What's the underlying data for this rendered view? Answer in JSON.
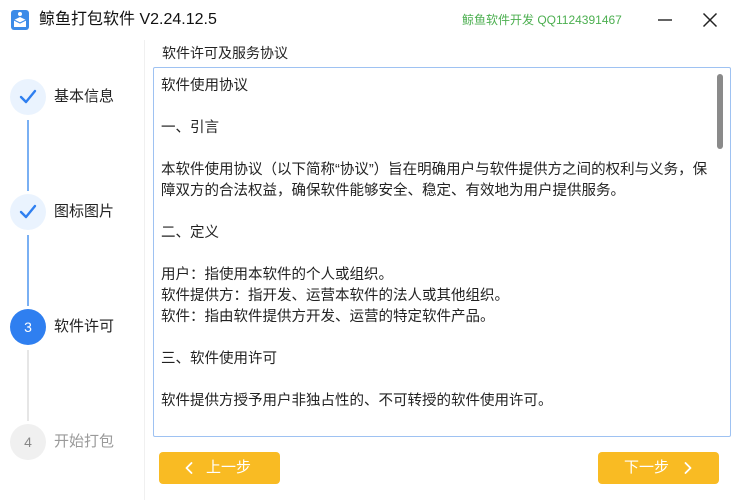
{
  "app": {
    "title": "鲸鱼打包软件 V2.24.12.5",
    "developer_info": "鲸鱼软件开发 QQ1124391467",
    "icon": "app-logo-icon"
  },
  "window_controls": {
    "minimize_icon": "minimize-icon",
    "close_icon": "close-icon"
  },
  "steps": [
    {
      "label": "基本信息",
      "status": "done",
      "marker": "✓"
    },
    {
      "label": "图标图片",
      "status": "done",
      "marker": "✓"
    },
    {
      "label": "软件许可",
      "status": "active",
      "marker": "3"
    },
    {
      "label": "开始打包",
      "status": "pending",
      "marker": "4"
    }
  ],
  "section_title": "软件许可及服务协议",
  "license": {
    "lines": [
      "软件使用协议",
      "",
      "一、引言",
      "",
      "本软件使用协议（以下简称“协议”）旨在明确用户与软件提供方之间的权利与义务，保障双方的合法权益，确保软件能够安全、稳定、有效地为用户提供服务。",
      "",
      "二、定义",
      "",
      "用户：指使用本软件的个人或组织。",
      "软件提供方：指开发、运营本软件的法人或其他组织。",
      "软件：指由软件提供方开发、运营的特定软件产品。",
      "",
      "三、软件使用许可",
      "",
      "软件提供方授予用户非独占性的、不可转授的软件使用许可。"
    ]
  },
  "buttons": {
    "prev_label": "上一步",
    "next_label": "下一步"
  },
  "colors": {
    "accent_blue": "#2f7ff0",
    "button_orange": "#f9bb23",
    "developer_green": "#4caf50"
  }
}
